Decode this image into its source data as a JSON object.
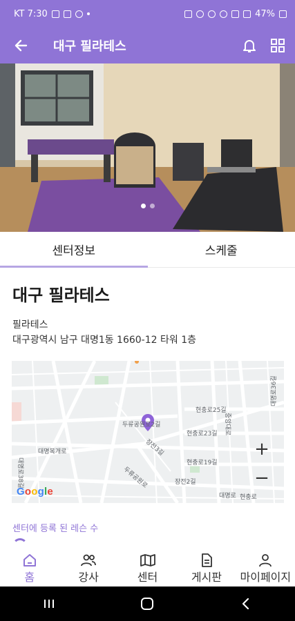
{
  "status_bar": {
    "carrier_time": "KT 7:30",
    "battery": "47%"
  },
  "app_bar": {
    "title": "대구 필라테스"
  },
  "hero": {
    "page_count": 2,
    "current_page": 1
  },
  "tabs": [
    {
      "label": "센터정보",
      "active": true
    },
    {
      "label": "스케줄",
      "active": false
    }
  ],
  "center": {
    "name": "대구 필라테스",
    "category": "필라테스",
    "address": "대구광역시 남구 대명1동 1660-12 타워 1층"
  },
  "map": {
    "labels": [
      "현충로25길",
      "현충로23길",
      "현충로19길",
      "두류공원로",
      "두류공원로2길",
      "장전2길",
      "장전3길",
      "대명복개로",
      "대명로",
      "대명로38길",
      "대명로36길",
      "중앙대로",
      "현충로"
    ],
    "zoom_in": "+",
    "zoom_out": "−",
    "provider": "Google"
  },
  "lessons": {
    "label": "센터에 등록 된 레슨 수"
  },
  "bottom_nav": [
    {
      "label": "홈",
      "icon": "home-icon",
      "active": true
    },
    {
      "label": "강사",
      "icon": "people-icon",
      "active": false
    },
    {
      "label": "센터",
      "icon": "map-icon",
      "active": false
    },
    {
      "label": "게시판",
      "icon": "document-icon",
      "active": false
    },
    {
      "label": "마이페이지",
      "icon": "person-icon",
      "active": false
    }
  ],
  "colors": {
    "accent": "#8f74d6",
    "tab_indicator": "#b6a6e3",
    "map_pin": "#8e63d8"
  }
}
